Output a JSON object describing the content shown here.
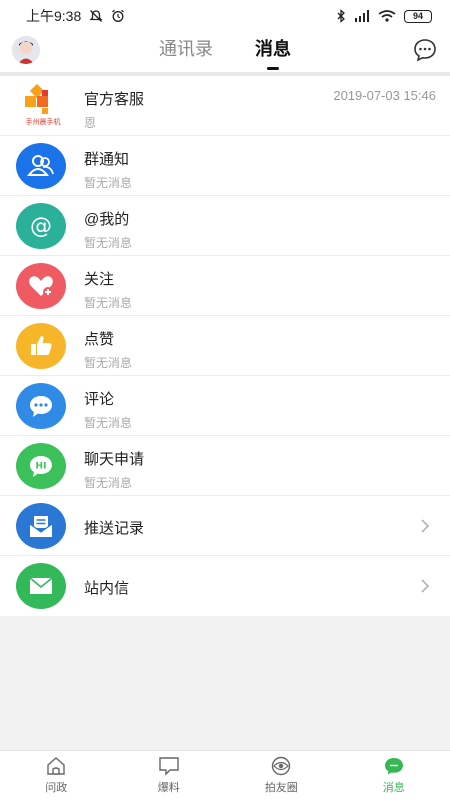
{
  "status_bar": {
    "time": "上午9:38",
    "battery": "94"
  },
  "header": {
    "tabs": [
      {
        "label": "通讯录"
      },
      {
        "label": "消息"
      }
    ]
  },
  "messages": [
    {
      "title": "官方客服",
      "subtitle": "恩",
      "time": "2019-07-03 15:46",
      "icon": "official-service-logo",
      "logo_text": "手州晨手机"
    },
    {
      "title": "群通知",
      "subtitle": "暂无消息",
      "icon": "group-icon",
      "color": "#1a73e8"
    },
    {
      "title": "@我的",
      "subtitle": "暂无消息",
      "icon": "at-icon",
      "color": "#2bb19a"
    },
    {
      "title": "关注",
      "subtitle": "暂无消息",
      "icon": "heart-plus-icon",
      "color": "#ef5b63"
    },
    {
      "title": "点赞",
      "subtitle": "暂无消息",
      "icon": "thumbs-up-icon",
      "color": "#f7b52a"
    },
    {
      "title": "评论",
      "subtitle": "暂无消息",
      "icon": "comment-icon",
      "color": "#2f8be6"
    },
    {
      "title": "聊天申请",
      "subtitle": "暂无消息",
      "icon": "chat-request-icon",
      "color": "#3cc05a",
      "badge_text": "HI"
    }
  ],
  "links": [
    {
      "title": "推送记录",
      "icon": "push-record-icon",
      "color": "#2a78d4"
    },
    {
      "title": "站内信",
      "icon": "mail-icon",
      "color": "#33b85a"
    }
  ],
  "bottom_nav": [
    {
      "label": "问政",
      "icon": "home-icon"
    },
    {
      "label": "爆料",
      "icon": "message-square-icon"
    },
    {
      "label": "拍友圈",
      "icon": "eye-circle-icon"
    },
    {
      "label": "消息",
      "icon": "chat-bubble-icon",
      "active": true
    }
  ],
  "colors": {
    "accent": "#34b853"
  }
}
